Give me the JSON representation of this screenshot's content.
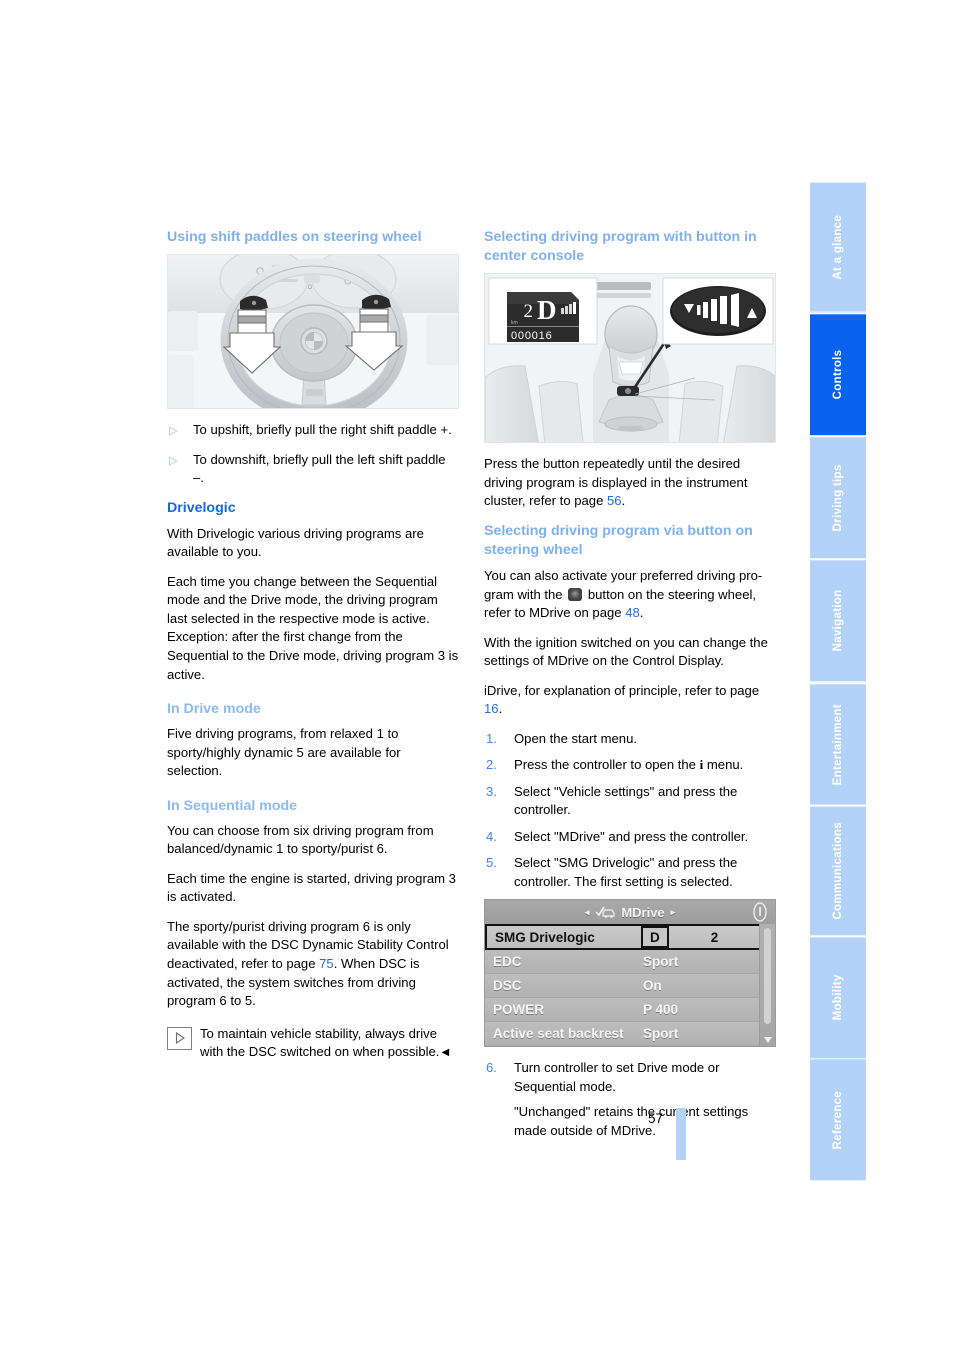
{
  "page": {
    "number": "57"
  },
  "sidebar": {
    "tabs": [
      {
        "label": "At a glance",
        "active": false
      },
      {
        "label": "Controls",
        "active": true
      },
      {
        "label": "Driving tips",
        "active": false
      },
      {
        "label": "Navigation",
        "active": false
      },
      {
        "label": "Entertainment",
        "active": false
      },
      {
        "label": "Communications",
        "active": false
      },
      {
        "label": "Mobility",
        "active": false
      },
      {
        "label": "Reference",
        "active": false
      }
    ]
  },
  "left_column": {
    "heading_paddles": "Using shift paddles on steering wheel",
    "figure_wheel": {
      "name": "steering-wheel-with-shift-paddles"
    },
    "bullets": [
      "To upshift, briefly pull the right shift paddle +.",
      "To downshift, briefly pull the left shift paddle –."
    ],
    "heading_drivelogic": "Drivelogic",
    "p_drivelogic_1": "With Drivelogic various driving programs are available to you.",
    "p_drivelogic_2": "Each time you change between the Sequential mode and the Drive mode, the driving program last selected in the respective mode is active. Exception: after the first change from the Sequential to the Drive mode, driving program 3 is active.",
    "heading_drive_mode": "In Drive mode",
    "p_drive_mode": "Five driving programs, from relaxed 1 to sporty/highly dynamic 5 are available for selection.",
    "heading_sequential_mode": "In Sequential mode",
    "p_seq_1": "You can choose from six driving program from balanced/dynamic 1 to sporty/purist 6.",
    "p_seq_2": "Each time the engine is started, driving program 3 is activated.",
    "p_seq_3a": "The sporty/purist driving program 6 is only available with the DSC Dynamic Stability Control deactivated, refer to page ",
    "p_seq_3_ref": "75",
    "p_seq_3b": ". When DSC is activated, the system switches from driving program 6 to 5.",
    "note_text": "To maintain vehicle stability, always drive with the DSC switched on when possible.",
    "note_endmark": "◀"
  },
  "right_column": {
    "heading_center_console": "Selecting driving program with button in center console",
    "figure_console": {
      "name": "center-console-drivelogic-button",
      "gear_display": {
        "gear_number": "2",
        "gear_letter": "D",
        "odometer": "000016",
        "unit": "km"
      }
    },
    "p_press_button_a": "Press the button repeatedly until the desired driving program is displayed in the instrument cluster, refer to page ",
    "p_press_button_ref": "56",
    "p_press_button_b": ".",
    "heading_steering_wheel": "Selecting driving program via button on steering wheel",
    "p_activate_a": "You can also activate your preferred driving pro-gram with the ",
    "p_activate_b": " button on the steering wheel, refer to MDrive on page ",
    "p_activate_ref": "48",
    "p_activate_c": ".",
    "p_ignition": "With the ignition switched on you can change the settings of MDrive on the Control Display.",
    "p_idrive_a": "iDrive, for explanation of principle, refer to page ",
    "p_idrive_ref": "16",
    "p_idrive_b": ".",
    "steps": [
      {
        "num": "1.",
        "text": "Open the start menu."
      },
      {
        "num": "2.",
        "text_a": "Press the controller to open the ",
        "icon": "i",
        "text_b": " menu."
      },
      {
        "num": "3.",
        "text": "Select \"Vehicle settings\" and press the controller."
      },
      {
        "num": "4.",
        "text": "Select \"MDrive\" and press the controller."
      },
      {
        "num": "5.",
        "text": "Select \"SMG Drivelogic\" and press the controller. The first setting is selected."
      }
    ],
    "mdrive_screen": {
      "title": "MDrive",
      "left_arrow": "◂",
      "right_arrow": "▸",
      "rows": [
        {
          "label": "SMG Drivelogic",
          "value": "D",
          "value2": "2",
          "selected": true
        },
        {
          "label": "EDC",
          "value": "Sport",
          "selected": false
        },
        {
          "label": "DSC",
          "value": "On",
          "selected": false
        },
        {
          "label": "POWER",
          "value": "P 400",
          "selected": false
        },
        {
          "label": "Active seat backrest",
          "value": "Sport",
          "selected": false
        }
      ]
    },
    "step6": {
      "num": "6.",
      "text": "Turn controller to set Drive mode or Sequential mode.",
      "cont": "\"Unchanged\" retains the current settings made outside of MDrive."
    }
  },
  "colors": {
    "heading_light_blue": "#8cbaf2",
    "heading_blue": "#1769e0",
    "reference_blue": "#1f6fe5",
    "tab_inactive": "#b3d2f7",
    "tab_active": "#0a63f0"
  }
}
